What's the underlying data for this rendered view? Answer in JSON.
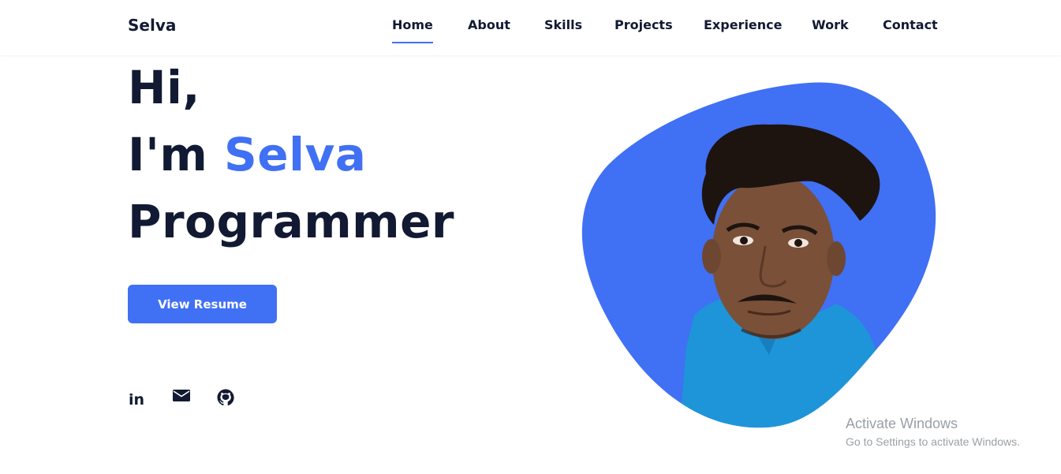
{
  "header": {
    "logo": "Selva",
    "nav": [
      {
        "label": "Home",
        "active": true
      },
      {
        "label": "About",
        "active": false
      },
      {
        "label": "Skills",
        "active": false
      },
      {
        "label": "Projects",
        "active": false
      },
      {
        "label": "Experience",
        "active": false
      },
      {
        "label": "Work",
        "active": false
      },
      {
        "label": "Contact",
        "active": false
      }
    ]
  },
  "hero": {
    "greeting": "Hi,",
    "intro_prefix": "I'm ",
    "name": "Selva",
    "role": "Programmer",
    "resume_button": "View Resume"
  },
  "social": [
    {
      "icon": "linkedin-icon",
      "label": "in"
    },
    {
      "icon": "mail-icon"
    },
    {
      "icon": "github-icon"
    }
  ],
  "watermark": {
    "title": "Activate Windows",
    "subtitle": "Go to Settings to activate Windows."
  },
  "colors": {
    "accent": "#4070f4",
    "text_dark": "#121a33",
    "shirt": "#1e95d8"
  }
}
